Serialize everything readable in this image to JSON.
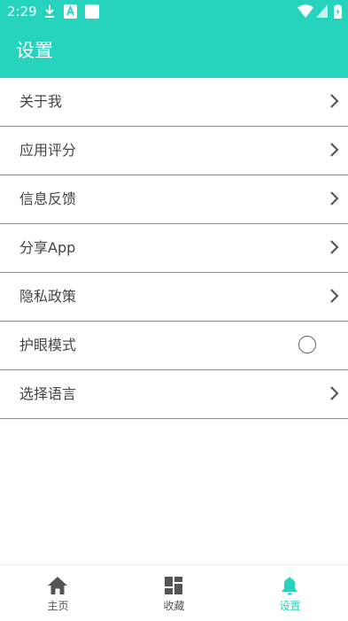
{
  "status_bar": {
    "time": "2:29",
    "icons": [
      "download-icon",
      "a-box-icon",
      "square-icon",
      "wifi-icon",
      "signal-icon",
      "battery-charging-icon"
    ]
  },
  "header": {
    "title": "设置"
  },
  "settings_items": [
    {
      "label": "关于我",
      "control": "chevron-right-icon"
    },
    {
      "label": "应用评分",
      "control": "chevron-right-icon"
    },
    {
      "label": "信息反馈",
      "control": "chevron-right-icon"
    },
    {
      "label": "分享App",
      "control": "chevron-right-icon"
    },
    {
      "label": "隐私政策",
      "control": "chevron-right-icon"
    },
    {
      "label": "护眼模式",
      "control": "radio-button",
      "checked": false
    },
    {
      "label": "选择语言",
      "control": "chevron-right-icon"
    }
  ],
  "bottom_nav": [
    {
      "label": "主页",
      "icon": "home-icon",
      "active": false
    },
    {
      "label": "收藏",
      "icon": "dashboard-icon",
      "active": false
    },
    {
      "label": "设置",
      "icon": "bell-icon",
      "active": true
    }
  ],
  "colors": {
    "accent": "#26d3bd",
    "text": "#444444",
    "divider": "#8a8a8a"
  }
}
